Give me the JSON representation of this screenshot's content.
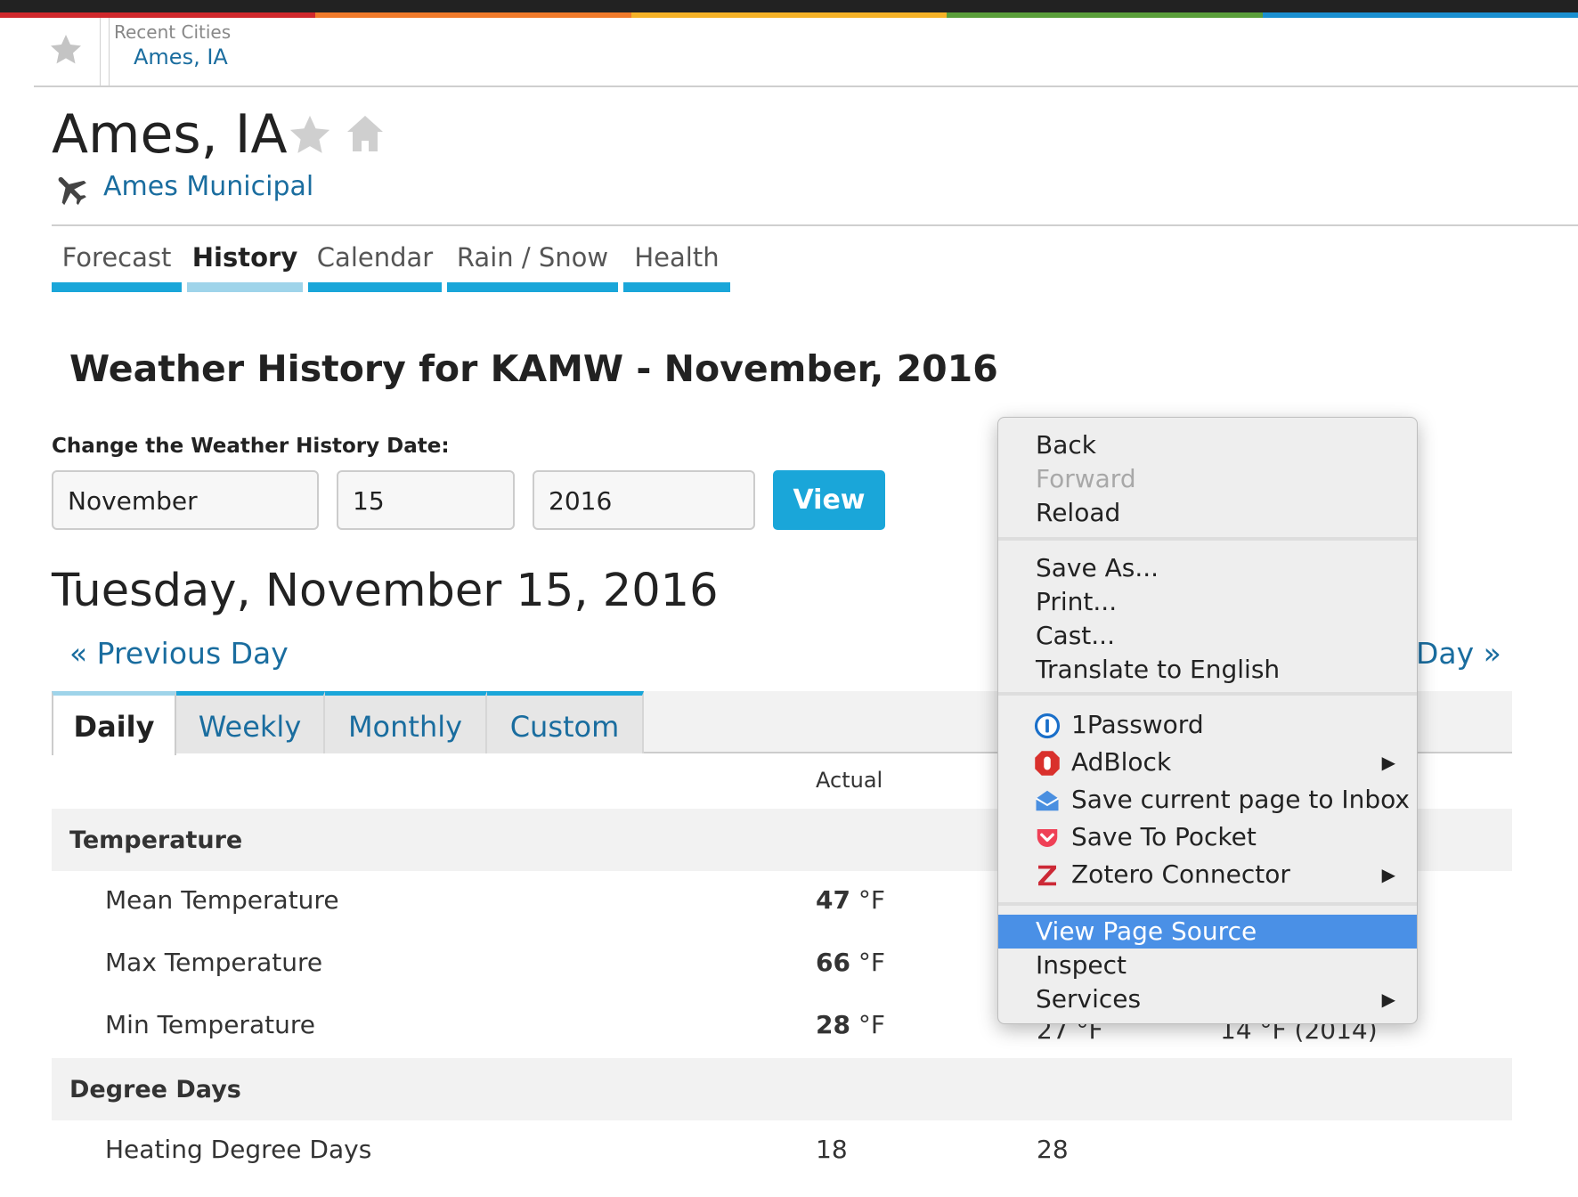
{
  "colors": {
    "strip": [
      "#d0282c",
      "#f07a2a",
      "#f5b227",
      "#5a9e3a",
      "#1a8fd0"
    ],
    "accent": "#1aa6d9",
    "link": "#1a6d9f",
    "menu_highlight": "#4a90e6"
  },
  "recent": {
    "label": "Recent Cities",
    "city": "Ames, IA"
  },
  "header": {
    "city": "Ames, IA",
    "station": "Ames Municipal"
  },
  "nav": {
    "tabs": [
      {
        "label": "Forecast",
        "active": false
      },
      {
        "label": "History",
        "active": true
      },
      {
        "label": "Calendar",
        "active": false
      },
      {
        "label": "Rain / Snow",
        "active": false
      },
      {
        "label": "Health",
        "active": false
      }
    ]
  },
  "main": {
    "title": "Weather History for KAMW - November, 2016",
    "form": {
      "label": "Change the Weather History Date:",
      "month": "November",
      "day": "15",
      "year": "2016",
      "button": "View"
    },
    "date_heading": "Tuesday, November 15, 2016",
    "prev_day": "« Previous Day",
    "next_day": "Day »",
    "range_tabs": [
      {
        "label": "Daily",
        "active": true
      },
      {
        "label": "Weekly",
        "active": false
      },
      {
        "label": "Monthly",
        "active": false
      },
      {
        "label": "Custom",
        "active": false
      }
    ],
    "table": {
      "actual_header": "Actual",
      "sections": [
        {
          "label": "Temperature",
          "rows": [
            {
              "label": "Mean Temperature",
              "actual": "47",
              "unit": "°F"
            },
            {
              "label": "Max Temperature",
              "actual": "66",
              "unit": "°F"
            },
            {
              "label": "Min Temperature",
              "actual": "28",
              "unit": "°F",
              "average": "27 °F",
              "record": "14 °F (2014)"
            }
          ]
        },
        {
          "label": "Degree Days",
          "rows": [
            {
              "label": "Heating Degree Days",
              "actual": "18",
              "average": "28"
            }
          ]
        }
      ]
    }
  },
  "context_menu": {
    "groups": [
      [
        {
          "label": "Back",
          "enabled": true
        },
        {
          "label": "Forward",
          "enabled": false
        },
        {
          "label": "Reload",
          "enabled": true
        }
      ],
      [
        {
          "label": "Save As...",
          "enabled": true
        },
        {
          "label": "Print...",
          "enabled": true
        },
        {
          "label": "Cast...",
          "enabled": true
        },
        {
          "label": "Translate to English",
          "enabled": true
        }
      ],
      [
        {
          "label": "1Password",
          "icon": "1password-icon"
        },
        {
          "label": "AdBlock",
          "icon": "adblock-icon",
          "submenu": true
        },
        {
          "label": "Save current page to Inbox",
          "icon": "inbox-icon"
        },
        {
          "label": "Save To Pocket",
          "icon": "pocket-icon"
        },
        {
          "label": "Zotero Connector",
          "icon": "zotero-icon",
          "submenu": true
        }
      ],
      [
        {
          "label": "View Page Source",
          "selected": true
        },
        {
          "label": "Inspect"
        },
        {
          "label": "Services",
          "submenu": true
        }
      ]
    ]
  }
}
